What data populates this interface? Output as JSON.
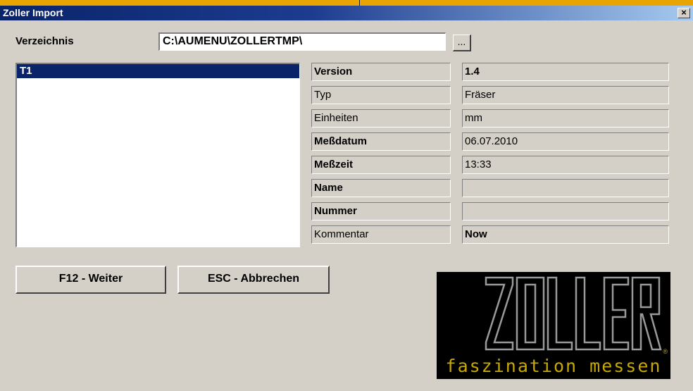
{
  "window": {
    "title": "Zoller Import",
    "close_glyph": "×"
  },
  "directory": {
    "label": "Verzeichnis",
    "value": "C:\\AUMENU\\ZOLLERTMP\\",
    "browse_label": "..."
  },
  "tool_list": {
    "items": [
      {
        "label": "T1",
        "selected": true
      }
    ]
  },
  "properties": [
    {
      "name": "Version",
      "value": "1.4"
    },
    {
      "name": "Typ",
      "value": "Fräser"
    },
    {
      "name": "Einheiten",
      "value": "mm"
    },
    {
      "name": "Meßdatum",
      "value": "06.07.2010"
    },
    {
      "name": "Meßzeit",
      "value": "13:33"
    },
    {
      "name": "Name",
      "value": ""
    },
    {
      "name": "Nummer",
      "value": ""
    },
    {
      "name": "Kommentar",
      "value": "Now"
    }
  ],
  "buttons": {
    "next_label": "F12 - Weiter",
    "cancel_label": "ESC - Abbrechen"
  },
  "logo": {
    "brand": "ZOLLER",
    "tagline": "faszination messen",
    "registered": "®",
    "colors": {
      "background": "#000000",
      "text": "#c8a800"
    }
  }
}
